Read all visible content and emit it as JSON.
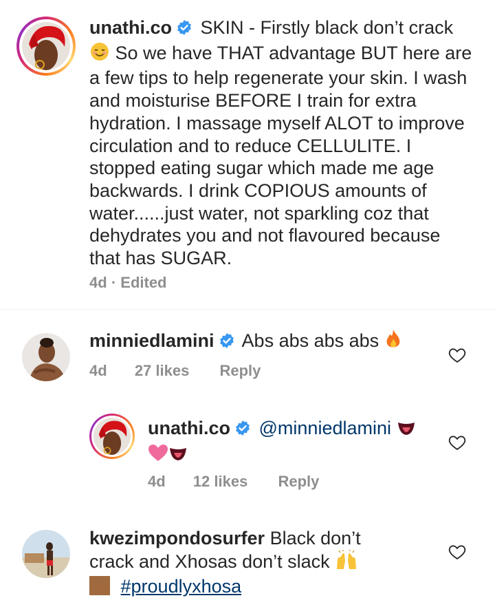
{
  "comments": [
    {
      "username": "unathi.co",
      "verified": true,
      "body_before_emoji": "SKIN - Firstly black don’t crack",
      "body_after_emoji": "So we have THAT advantage BUT here are a few tips to help regenerate your skin. I wash and moisturise BEFORE I train for extra hydration. I massage myself ALOT to improve circulation and to reduce CELLULITE. I stopped eating sugar which made me age backwards. I drink COPIOUS amounts of water......just water, not sparkling coz that dehydrates you and not flavoured because that has SUGAR.",
      "emoji": "smiling-face-emoji",
      "time": "4d",
      "separator": "·",
      "edited": "Edited"
    },
    {
      "username": "minniedlamini",
      "verified": true,
      "body": "Abs abs abs abs",
      "emoji": "fire-emoji",
      "time": "4d",
      "likes": "27 likes",
      "reply": "Reply"
    },
    {
      "username": "unathi.co",
      "verified": true,
      "mention": "@minniedlamini",
      "emoji": "tongue-emoji",
      "second_line_emojis": [
        "heart-emoji",
        "tongue-emoji"
      ],
      "time": "4d",
      "likes": "12 likes",
      "reply": "Reply"
    },
    {
      "username": "kwezimpondosurfer",
      "body_line1": "Black don’t",
      "body_line2": "crack and Xhosas don’t slack",
      "emoji": "raising-hands-emoji",
      "hashtag": "#proudlyxhosa"
    }
  ],
  "colors": {
    "text": "#262626",
    "secondary": "#8e8e8e",
    "verified": "#3897f0",
    "link": "#00376b",
    "divider": "#efefef"
  }
}
